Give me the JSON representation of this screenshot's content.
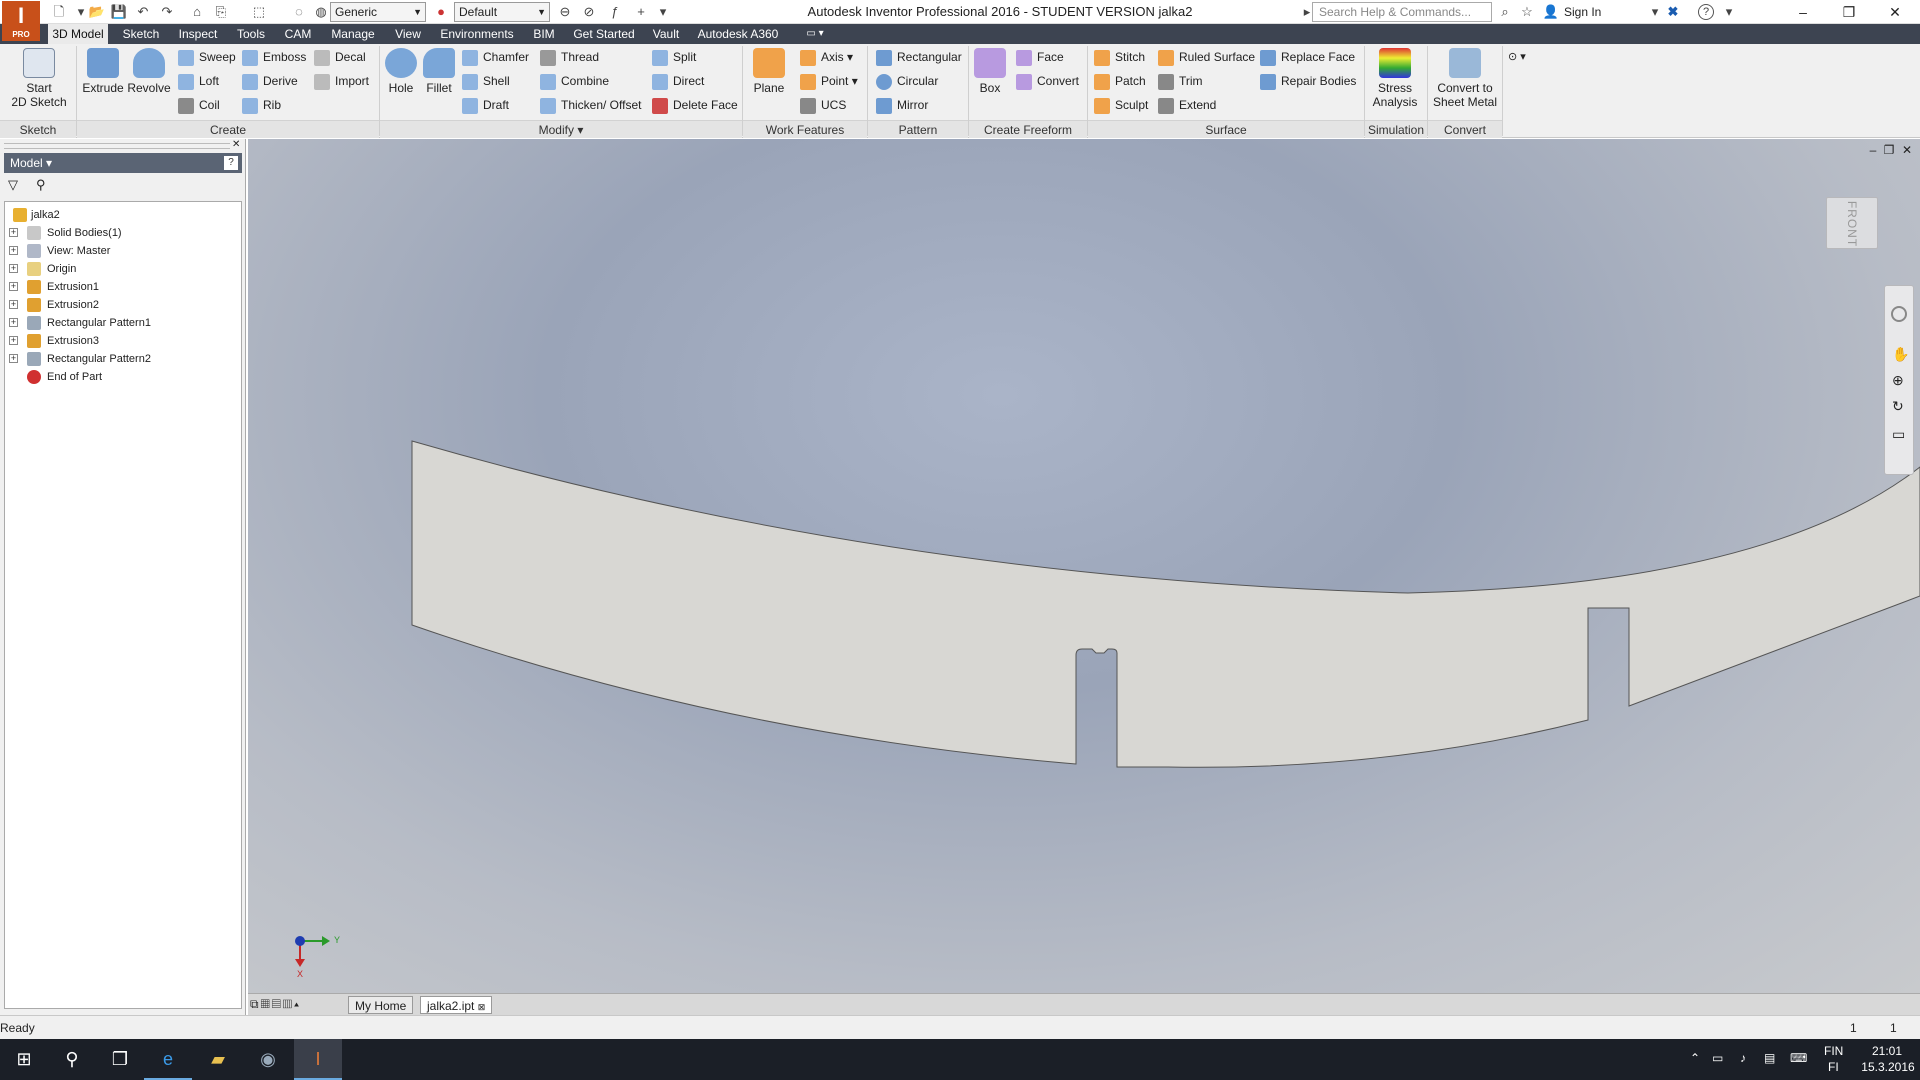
{
  "app": {
    "logo_text": "I",
    "logo_sub": "PRO",
    "window_title": "Autodesk Inventor Professional 2016 - STUDENT VERSION   jalka2",
    "search_placeholder": "Search Help & Commands...",
    "sign_in": "Sign In",
    "material_combo": "Generic",
    "appearance_combo": "Default",
    "minimize": "–",
    "restore": "❐",
    "close": "✕",
    "help": "?"
  },
  "tabs": [
    {
      "label": "3D Model",
      "active": true
    },
    {
      "label": "Sketch"
    },
    {
      "label": "Inspect"
    },
    {
      "label": "Tools"
    },
    {
      "label": "CAM"
    },
    {
      "label": "Manage"
    },
    {
      "label": "View"
    },
    {
      "label": "Environments"
    },
    {
      "label": "BIM"
    },
    {
      "label": "Get Started"
    },
    {
      "label": "Vault"
    },
    {
      "label": "Autodesk A360"
    }
  ],
  "ribbon": {
    "sketch": {
      "start_2d_sketch": "Start\n2D Sketch",
      "panel": "Sketch"
    },
    "create": {
      "extrude": "Extrude",
      "revolve": "Revolve",
      "sweep": "Sweep",
      "loft": "Loft",
      "coil": "Coil",
      "emboss": "Emboss",
      "derive": "Derive",
      "rib": "Rib",
      "decal": "Decal",
      "import": "Import",
      "panel": "Create"
    },
    "modify": {
      "hole": "Hole",
      "fillet": "Fillet",
      "chamfer": "Chamfer",
      "shell": "Shell",
      "draft": "Draft",
      "thread": "Thread",
      "combine": "Combine",
      "thicken": "Thicken/ Offset",
      "split": "Split",
      "direct": "Direct",
      "delete_face": "Delete Face",
      "panel": "Modify ▾"
    },
    "work_features": {
      "plane": "Plane",
      "axis": "Axis",
      "point": "Point",
      "ucs": "UCS",
      "panel": "Work Features"
    },
    "pattern": {
      "rectangular": "Rectangular",
      "circular": "Circular",
      "mirror": "Mirror",
      "panel": "Pattern"
    },
    "freeform": {
      "box": "Box",
      "face": "Face",
      "convert": "Convert",
      "panel": "Create Freeform"
    },
    "surface": {
      "stitch": "Stitch",
      "patch": "Patch",
      "sculpt": "Sculpt",
      "ruled_surface": "Ruled Surface",
      "trim": "Trim",
      "extend": "Extend",
      "replace_face": "Replace Face",
      "repair_bodies": "Repair Bodies",
      "panel": "Surface"
    },
    "simulation": {
      "stress": "Stress\nAnalysis",
      "panel": "Simulation"
    },
    "convert": {
      "sheet_metal": "Convert to\nSheet Metal",
      "panel": "Convert"
    }
  },
  "browser": {
    "title": "Model ▾",
    "help_btn": "?",
    "close_btn": "✕",
    "tree": [
      {
        "label": "jalka2",
        "icon": "part-icon",
        "expander": ""
      },
      {
        "label": "Solid Bodies(1)",
        "icon": "solid-bodies-icon",
        "expander": "+"
      },
      {
        "label": "View: Master",
        "icon": "view-icon",
        "expander": "+"
      },
      {
        "label": "Origin",
        "icon": "folder-icon",
        "expander": "+"
      },
      {
        "label": "Extrusion1",
        "icon": "extrusion-icon",
        "expander": "+"
      },
      {
        "label": "Extrusion2",
        "icon": "extrusion-icon",
        "expander": "+"
      },
      {
        "label": "Rectangular Pattern1",
        "icon": "pattern-icon",
        "expander": "+"
      },
      {
        "label": "Extrusion3",
        "icon": "extrusion-icon",
        "expander": "+"
      },
      {
        "label": "Rectangular Pattern2",
        "icon": "pattern-icon",
        "expander": "+"
      },
      {
        "label": "End of Part",
        "icon": "end-of-part-icon",
        "expander": ""
      }
    ]
  },
  "viewport": {
    "viewcube_label": "FRONT",
    "axis_y": "Y",
    "axis_x": "X",
    "min": "–",
    "restore": "❐",
    "close": "✕"
  },
  "doctabs": {
    "home": "My Home",
    "file": "jalka2.ipt",
    "file_close": "⊠"
  },
  "status": {
    "text": "Ready",
    "count1": "1",
    "count2": "1"
  },
  "taskbar": {
    "lang": "FIN",
    "lang_sub": "FI",
    "time": "21:01",
    "date": "15.3.2016"
  }
}
